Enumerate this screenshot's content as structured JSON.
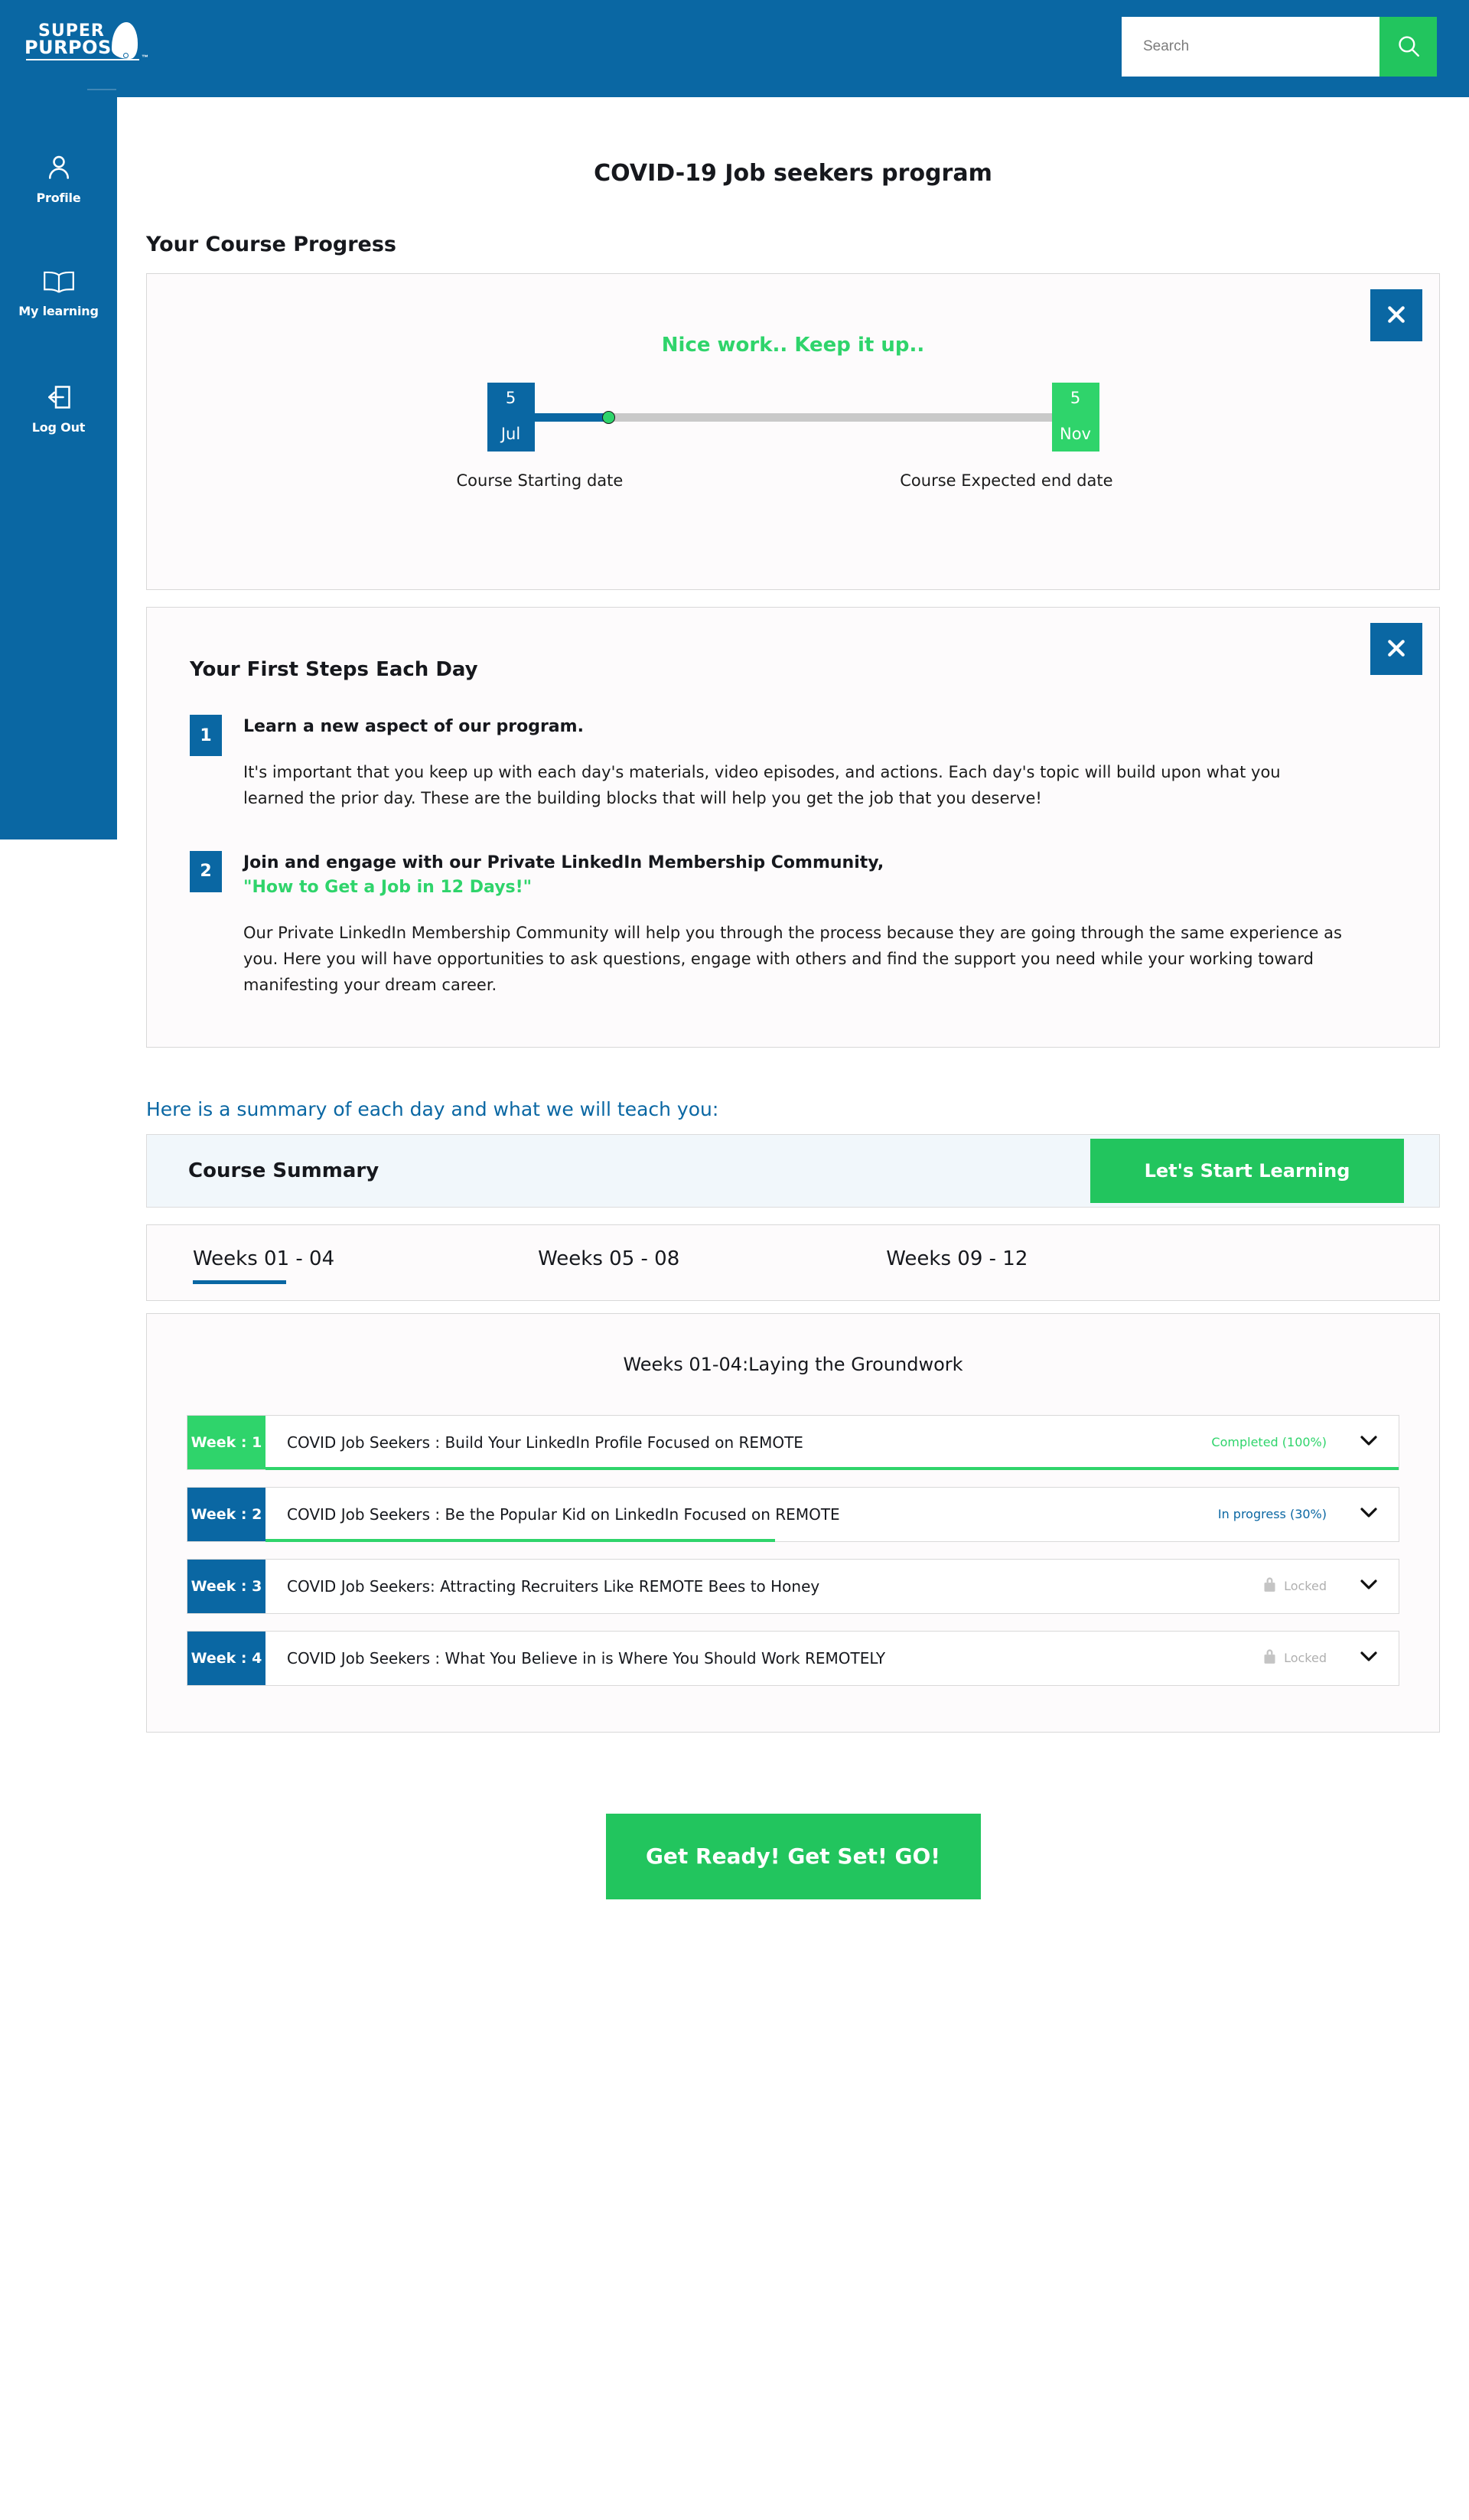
{
  "brand": {
    "logo_line1": "Super",
    "logo_line2": "Purposes",
    "trademark": "™"
  },
  "search": {
    "placeholder": "Search",
    "value": ""
  },
  "sidebar": {
    "items": [
      {
        "label": "Profile",
        "icon": "user-icon"
      },
      {
        "label": "My learning",
        "icon": "book-icon"
      },
      {
        "label": "Log Out",
        "icon": "logout-icon"
      }
    ]
  },
  "main": {
    "page_title": "COVID-19 Job seekers program",
    "progress_section_title": "Your Course Progress"
  },
  "progress_card": {
    "encouragement": "Nice work.. Keep it up..",
    "start": {
      "day": "5",
      "month": "Jul",
      "label": "Course Starting date"
    },
    "end": {
      "day": "5",
      "month": "Nov",
      "label": "Course Expected end date"
    },
    "close_icon": "close-icon"
  },
  "steps_card": {
    "title": "Your First Steps Each Day",
    "close_icon": "close-icon",
    "steps": [
      {
        "number": "1",
        "heading": "Learn a new aspect of our program.",
        "quote": "",
        "body": "It's important that you keep up with each day's materials, video episodes, and actions. Each day's topic will build upon what you learned the prior day. These are the building blocks that will help you get the job that you deserve!"
      },
      {
        "number": "2",
        "heading": "Join and engage with our Private LinkedIn Membership Community,",
        "quote": "\"How to Get a Job in 12 Days!\"",
        "body": "Our Private LinkedIn Membership Community will help you through the process because they are going through the same experience as you. Here you will have opportunities to ask questions, engage with others and find the support you need while your working toward manifesting your dream career."
      }
    ]
  },
  "summary": {
    "heading": "Here is a summary of each day and what we will teach you:",
    "bar_title": "Course Summary",
    "start_learning_label": "Let's Start Learning"
  },
  "tabs": [
    {
      "label": "Weeks 01 - 04",
      "active": true
    },
    {
      "label": "Weeks 05 - 08",
      "active": false
    },
    {
      "label": "Weeks 09 - 12",
      "active": false
    }
  ],
  "weeks_panel": {
    "title": "Weeks 01-04:Laying the Groundwork",
    "rows": [
      {
        "tag": "Week : 1",
        "name": "COVID Job Seekers : Build Your LinkedIn Profile Focused on REMOTE",
        "status": "Completed (100%)",
        "state": "completed",
        "percent": 100,
        "locked": false,
        "chevron_icon": "chevron-down-icon"
      },
      {
        "tag": "Week : 2",
        "name": "COVID Job Seekers : Be the Popular Kid on LinkedIn Focused on REMOTE",
        "status": "In progress (30%)",
        "state": "inprogress",
        "percent": 45,
        "locked": false,
        "chevron_icon": "chevron-down-icon"
      },
      {
        "tag": "Week : 3",
        "name": "COVID Job Seekers: Attracting Recruiters Like REMOTE Bees to Honey",
        "status": "Locked",
        "state": "locked",
        "percent": 0,
        "locked": true,
        "chevron_icon": "chevron-down-icon"
      },
      {
        "tag": "Week : 4",
        "name": "COVID Job Seekers : What You Believe in is Where You Should Work REMOTELY",
        "status": "Locked",
        "state": "locked",
        "percent": 0,
        "locked": true,
        "chevron_icon": "chevron-down-icon"
      }
    ]
  },
  "cta": {
    "label": "Get Ready! Get Set! GO!"
  },
  "colors": {
    "brand_blue": "#0a67a3",
    "accent_green": "#22c55e",
    "status_green": "#2fd46b",
    "locked_grey": "#b0b0b0",
    "card_bg": "#fdfbfc",
    "summary_bar_bg": "#f1f7fb"
  }
}
